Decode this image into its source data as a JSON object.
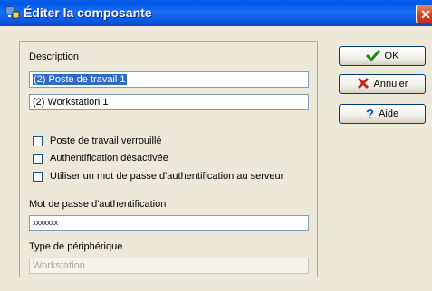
{
  "window": {
    "title": "Éditer la composante",
    "close_glyph": "✕"
  },
  "description": {
    "label": "Description",
    "field1_value": "(2) Poste de travail 1",
    "field2_value": "(2) Workstation 1"
  },
  "checkboxes": [
    {
      "label": "Poste de travail verrouillé",
      "checked": false
    },
    {
      "label": "Authentification désactivée",
      "checked": false
    },
    {
      "label": "Utiliser un mot de passe d'authentification au serveur",
      "checked": false
    }
  ],
  "password": {
    "label": "Mot de passe d'authentification",
    "value": "xxxxxxx"
  },
  "device_type": {
    "label": "Type de périphérique",
    "value": "Workstation"
  },
  "buttons": {
    "ok": {
      "label": "OK",
      "icon": "checkmark-icon",
      "color": "#1a8a1a"
    },
    "cancel": {
      "label": "Annuler",
      "icon": "red-x-icon",
      "color": "#c0281c"
    },
    "help": {
      "label": "Aide",
      "icon": "question-icon",
      "color": "#1a4fc0"
    }
  }
}
